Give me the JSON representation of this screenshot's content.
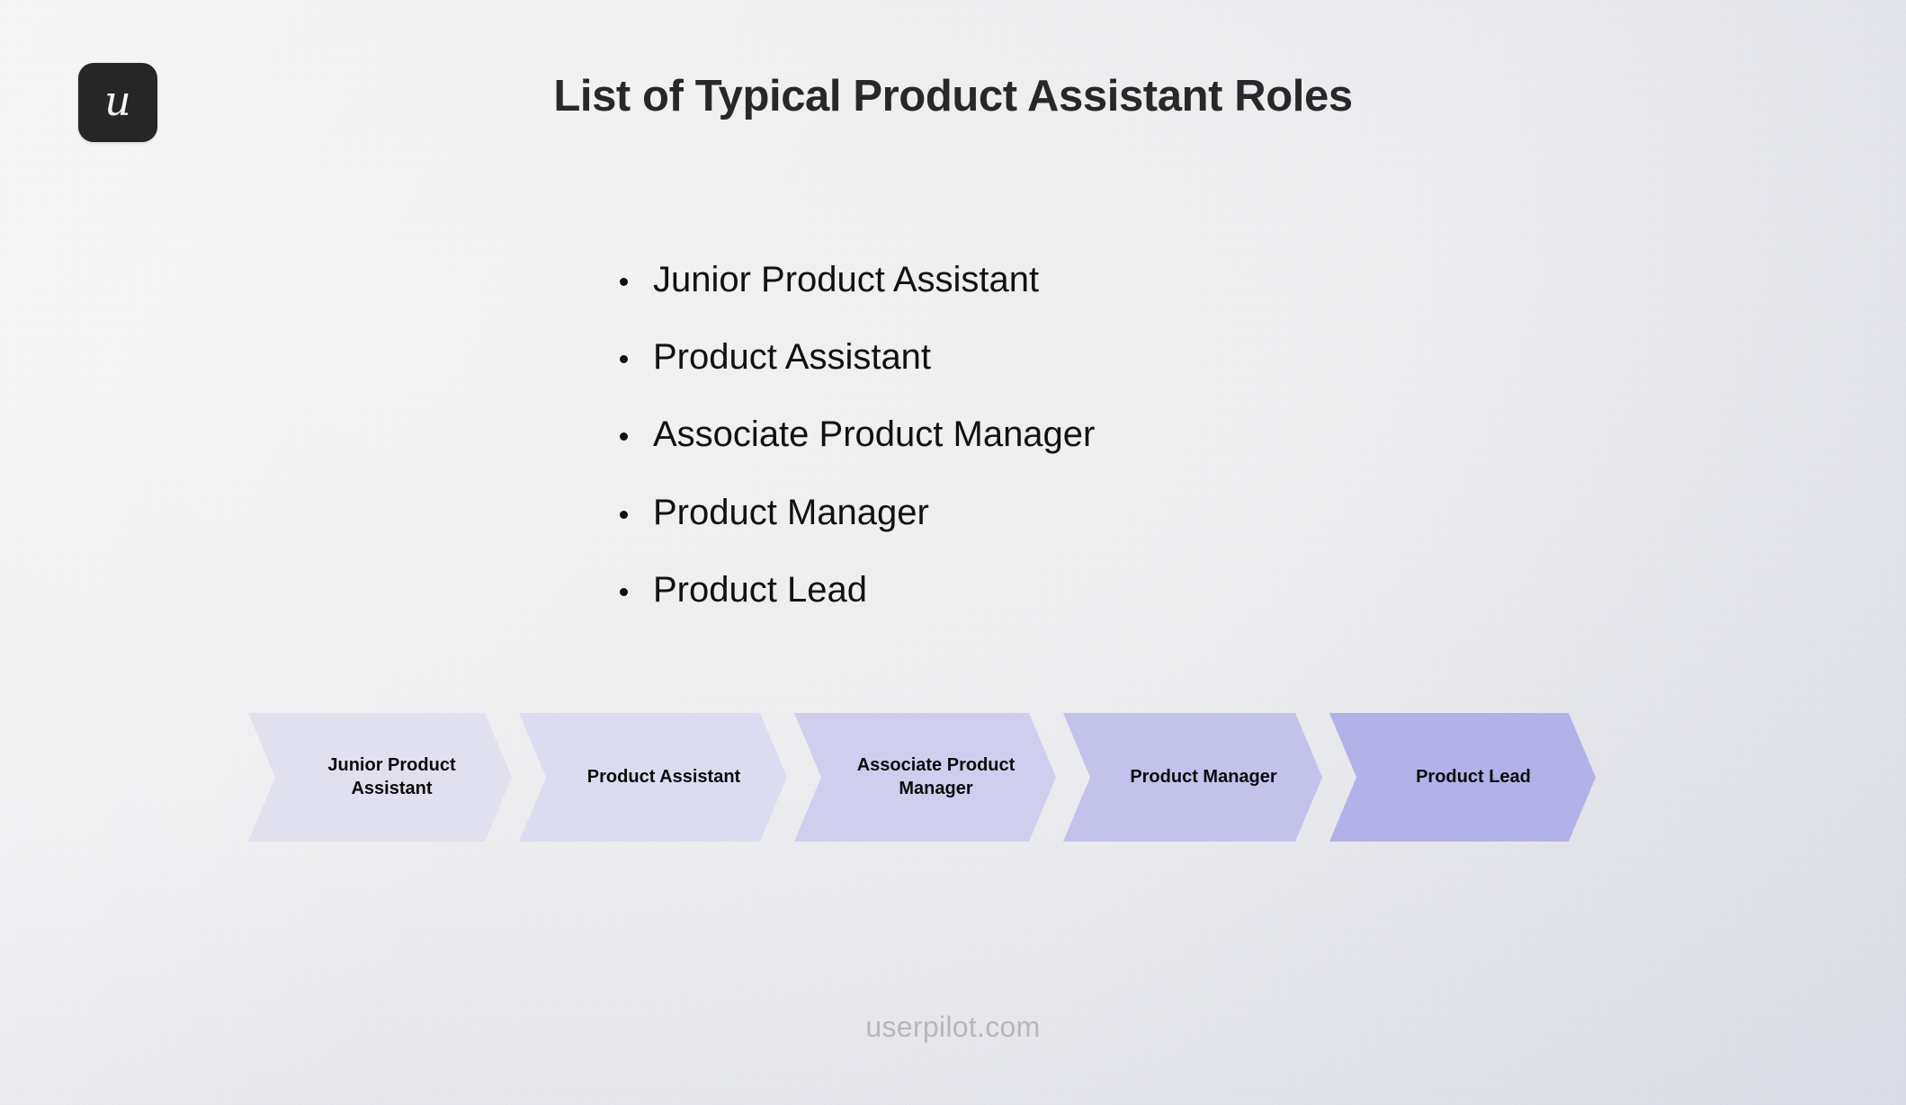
{
  "slide": {
    "title": "List of Typical Product Assistant Roles",
    "background_color": "#f0f0f2",
    "title_color": "#272829"
  },
  "logo": {
    "glyph": "u",
    "name": "userpilot-logo",
    "background_color": "#262626",
    "glyph_color": "#f4f4f4"
  },
  "bullets": {
    "items": [
      {
        "label": "Junior Product Assistant"
      },
      {
        "label": "Product Assistant"
      },
      {
        "label": "Associate Product Manager"
      },
      {
        "label": "Product Manager"
      },
      {
        "label": "Product Lead"
      }
    ]
  },
  "process": {
    "type": "chevron-progression",
    "steps": [
      {
        "label": "Junior Product Assistant",
        "fill": "#e0e0ef",
        "border": "#4a4a52"
      },
      {
        "label": "Product Assistant",
        "fill": "#dcdcf0",
        "border": "#4a4a52"
      },
      {
        "label": "Associate Product Manager",
        "fill": "#cfcfed",
        "border": "#4a4a52"
      },
      {
        "label": "Product Manager",
        "fill": "#c2c2ea",
        "border": "#4a4a52"
      },
      {
        "label": "Product Lead",
        "fill": "#b2b2e8",
        "border": "#4a4a52"
      }
    ]
  },
  "footer": {
    "text": "userpilot.com",
    "color": "#b6b8bd"
  }
}
